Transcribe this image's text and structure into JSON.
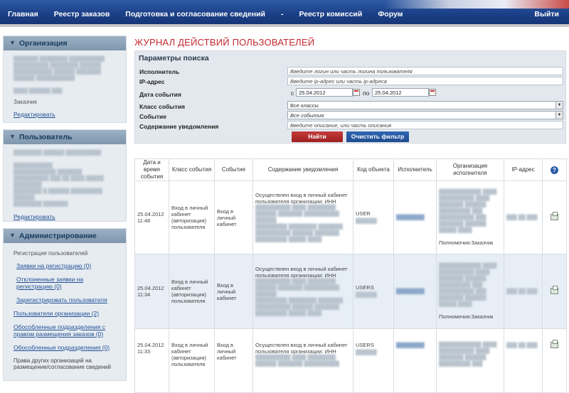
{
  "nav": {
    "items": [
      "Главная",
      "Реестр заказов",
      "Подготовка и согласование сведений",
      "Реестр комиссий",
      "Форум"
    ],
    "separator": "-",
    "logout": "Выйти"
  },
  "sidebar": {
    "organization": {
      "title": "Организация",
      "role": "Заказчик",
      "edit": "Редактировать"
    },
    "user": {
      "title": "Пользователь",
      "edit": "Редактировать"
    },
    "admin": {
      "title": "Администрирование",
      "section": "Регистрация пользователей",
      "links": [
        "Заявки на регистрацию (0)",
        "Отклоненные заявки на регистрацию (0)",
        "Зарегистрировать пользователя",
        "Пользователи организации (2)",
        "Обособленные подразделения с правом размещения заказов (0)",
        "Обособленные подразделения (0)"
      ],
      "footer": "Права других организаций на размещение/согласование сведений"
    }
  },
  "main": {
    "title": "ЖУРНАЛ ДЕЙСТВИЙ ПОЛЬЗОВАТЕЛЕЙ",
    "params_title": "Параметры поиска",
    "labels": {
      "user": "Исполнитель",
      "ip": "IP-адрес",
      "date": "Дата события",
      "event_class": "Класс события",
      "event": "Событие",
      "content": "Содержание уведомления"
    },
    "placeholders": {
      "user": "Введите логин или часть логина пользователя",
      "ip": "Введите ip-адрес или часть ip-адреса",
      "content": "Введите описание, или часть описания"
    },
    "date_from_label": "с",
    "date_to_label": "по",
    "date_from": "25.04.2012",
    "date_to": "25.04.2012",
    "event_class_value": "Все классы",
    "event_value": "Все события",
    "find": "Найти",
    "clear": "Очистить фильтр"
  },
  "table": {
    "headers": [
      "Дата и время события",
      "Класс события",
      "Событие",
      "Содержание уведомления",
      "Код объекта",
      "Исполнитель",
      "Организация исполнителя",
      "IP-адрес",
      "?"
    ],
    "rows": [
      {
        "datetime": "25.04.2012 11:48",
        "class": "Вход в личный кабинет (авторизация) пользователя",
        "event": "Вход в личный кабинет",
        "content": "Осуществлен вход в личный кабинет пользователя организации: ИНН",
        "code": "USER",
        "powers": "Полномочия:Заказчик"
      },
      {
        "datetime": "25.04.2012 11:34",
        "class": "Вход в личный кабинет (авторизация) пользователя",
        "event": "Вход в личный кабинет",
        "content": "Осуществлен вход в личный кабинет пользователя организации: ИНН",
        "code": "USERS",
        "powers": "Полномочия:Заказчик"
      },
      {
        "datetime": "25.04.2012 11:33",
        "class": "Вход в личный кабинет (авторизация) пользователя",
        "event": "Вход в личный кабинет",
        "content": "Осуществлен вход в личный кабинет пользователя организации: ИНН",
        "code": "USERS",
        "powers": ""
      }
    ]
  }
}
